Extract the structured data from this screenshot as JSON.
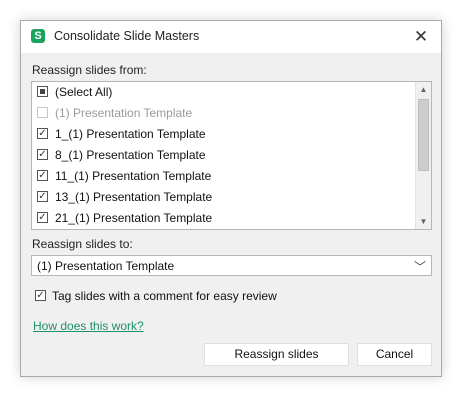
{
  "window": {
    "title": "Consolidate Slide Masters",
    "app_icon_letter": "S",
    "close_glyph": "✕"
  },
  "reassign_from": {
    "label": "Reassign slides from:",
    "items": [
      {
        "label": "(Select All)",
        "state": "indeterminate",
        "enabled": true
      },
      {
        "label": "(1) Presentation Template",
        "state": "unchecked",
        "enabled": false
      },
      {
        "label": "1_(1) Presentation Template",
        "state": "checked",
        "enabled": true
      },
      {
        "label": "8_(1) Presentation Template",
        "state": "checked",
        "enabled": true
      },
      {
        "label": "11_(1) Presentation Template",
        "state": "checked",
        "enabled": true
      },
      {
        "label": "13_(1) Presentation Template",
        "state": "checked",
        "enabled": true
      },
      {
        "label": "21_(1) Presentation Template",
        "state": "checked",
        "enabled": true
      }
    ],
    "scroll_up_glyph": "▲",
    "scroll_down_glyph": "▼"
  },
  "reassign_to": {
    "label": "Reassign slides to:",
    "selected": "(1) Presentation Template",
    "chevron_glyph": "﹀"
  },
  "tag_option": {
    "label": "Tag slides with a comment for easy review",
    "checked": true
  },
  "help_link": "How does this work?",
  "buttons": {
    "reassign": "Reassign slides",
    "cancel": "Cancel"
  },
  "colors": {
    "app_icon": "#1ca25f",
    "link": "#1c8f6b"
  },
  "icons": {
    "app": "app-logo-icon",
    "close": "close-icon",
    "check": "checkmark-icon",
    "dropdown": "chevron-down-icon"
  }
}
